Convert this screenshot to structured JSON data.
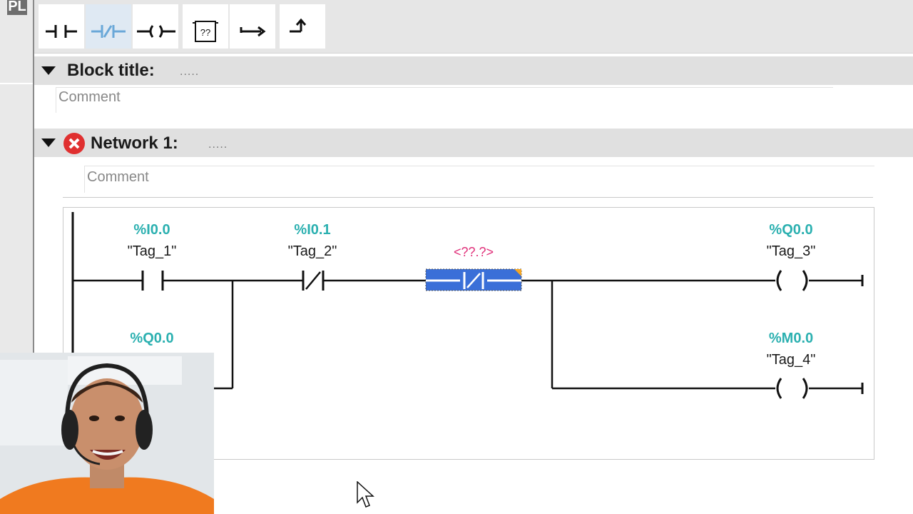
{
  "side_panel": {
    "tab_label": "PL"
  },
  "toolbar": {
    "buttons": [
      {
        "name": "normally-open-contact-icon",
        "active": false
      },
      {
        "name": "normally-closed-contact-icon",
        "active": true
      },
      {
        "name": "coil-icon",
        "active": false
      },
      {
        "name": "empty-box-icon",
        "label": "??",
        "active": false
      },
      {
        "name": "open-branch-icon",
        "active": false
      },
      {
        "name": "close-branch-icon",
        "active": false
      }
    ]
  },
  "block": {
    "title_label": "Block title:",
    "title_value": ".....",
    "comment_placeholder": "Comment"
  },
  "network": {
    "title_label": "Network 1:",
    "title_value": ".....",
    "has_error": true,
    "comment_placeholder": "Comment",
    "elements": [
      {
        "kind": "no-contact",
        "address": "%I0.0",
        "tag": "\"Tag_1\""
      },
      {
        "kind": "nc-contact",
        "address": "%I0.1",
        "tag": "\"Tag_2\""
      },
      {
        "kind": "nc-contact-empty",
        "address": "<??.?>",
        "selected": true
      },
      {
        "kind": "coil",
        "address": "%Q0.0",
        "tag": "\"Tag_3\""
      },
      {
        "kind": "no-contact-parallel",
        "address": "%Q0.0"
      },
      {
        "kind": "coil",
        "address": "%M0.0",
        "tag": "\"Tag_4\""
      }
    ]
  },
  "colors": {
    "address": "#2bb0b0",
    "placeholder": "#e0307a",
    "selection": "#3a6fd8",
    "error": "#e03030"
  }
}
